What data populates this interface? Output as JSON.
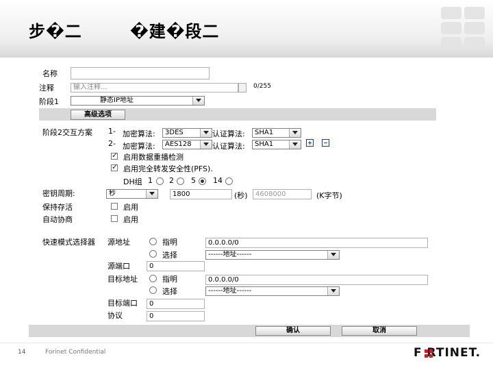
{
  "slide": {
    "title_left": "步�二",
    "title_right": "�建�段二",
    "page_number": "14",
    "confidential": "Forinet Confidential",
    "logo": "F RTINET."
  },
  "form": {
    "name_label": "名称",
    "comment_label": "注释",
    "comment_placeholder": "输入注释...",
    "comment_count": "0/255",
    "phase1_label": "阶段1",
    "phase1_value": "静态IP地址",
    "advanced_button": "高级选项",
    "proposal_label": "阶段2交互方案",
    "proposals": [
      {
        "num": "1-",
        "enc_label": "加密算法:",
        "enc_value": "3DES",
        "auth_label": "认证算法:",
        "auth_value": "SHA1"
      },
      {
        "num": "2-",
        "enc_label": "加密算法:",
        "enc_value": "AES128",
        "auth_label": "认证算法:",
        "auth_value": "SHA1"
      }
    ],
    "replay_label": "启用数据重播检测",
    "pfs_label": "启用完全转发安全性(PFS).",
    "dh_label": "DH组",
    "dh_options": [
      "1",
      "2",
      "5",
      "14"
    ],
    "lifetime_label": "密钥周期:",
    "lifetime_unit_value": "秒",
    "lifetime_seconds": "1800",
    "seconds_label": "(秒)",
    "lifetime_kb": "4608000",
    "kb_label": "(K字节)",
    "keepalive_label": "保持存活",
    "keepalive_enable": "启用",
    "autonego_label": "自动协商",
    "autonego_enable": "启用",
    "selector_label": "快速模式选择器",
    "src_addr_label": "源地址",
    "specify_label": "指明",
    "select_label": "选择",
    "src_addr_value": "0.0.0.0/0",
    "addr_select_value": "------地址------",
    "src_port_label": "源端口",
    "src_port_value": "0",
    "dst_addr_label": "目标地址",
    "dst_addr_value": "0.0.0.0/0",
    "dst_port_label": "目标端口",
    "dst_port_value": "0",
    "protocol_label": "协议",
    "protocol_value": "0",
    "ok_button": "确认",
    "cancel_button": "取消"
  },
  "colors": {
    "bar": "#d8d8d8",
    "logo_red": "#d71920"
  }
}
